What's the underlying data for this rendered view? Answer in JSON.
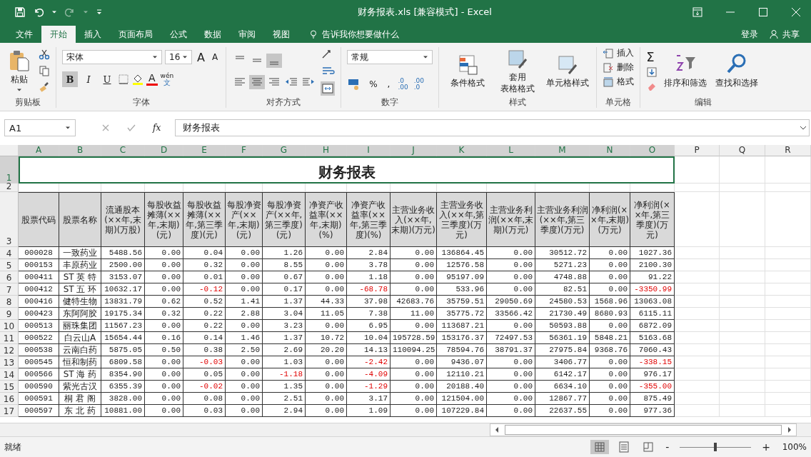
{
  "window": {
    "title": "财务报表.xls  [兼容模式] - Excel"
  },
  "tabs": [
    {
      "label": "文件",
      "selected": false
    },
    {
      "label": "开始",
      "selected": true
    },
    {
      "label": "插入",
      "selected": false
    },
    {
      "label": "页面布局",
      "selected": false
    },
    {
      "label": "公式",
      "selected": false
    },
    {
      "label": "数据",
      "selected": false
    },
    {
      "label": "审阅",
      "selected": false
    },
    {
      "label": "视图",
      "selected": false
    }
  ],
  "tell_me": "告诉我你想要做什么",
  "sign_in": "登录",
  "share": "共享",
  "ribbon": {
    "clipboard": {
      "label": "剪贴板",
      "paste": "粘贴"
    },
    "font": {
      "label": "字体",
      "font": "宋体",
      "size": "16",
      "grow": "A",
      "shrink": "A",
      "bold": {
        "text": "B",
        "selected": true
      },
      "italic": {
        "text": "I",
        "selected": false
      },
      "underline": {
        "text": "U",
        "selected": false
      },
      "phonetic": [
        "wén",
        "文"
      ],
      "font_color": "A"
    },
    "alignment": {
      "label": "对齐方式",
      "buttons": [
        {
          "kind": "top",
          "selected": false
        },
        {
          "kind": "middle",
          "selected": false
        },
        {
          "kind": "bottom",
          "selected": true
        },
        {
          "kind": "left",
          "selected": false
        },
        {
          "kind": "center",
          "selected": true
        },
        {
          "kind": "right",
          "selected": false
        },
        {
          "kind": "outdent",
          "selected": false
        },
        {
          "kind": "indent",
          "selected": false
        }
      ],
      "merge_selected": true
    },
    "number": {
      "label": "数字",
      "format": "常规",
      "percent": "%",
      "comma": ",",
      "increase_decimal": [
        ".0",
        ".00"
      ],
      "decrease_decimal": [
        ".00",
        ".0"
      ]
    },
    "styles": {
      "label": "样式",
      "buttons": [
        [
          "条件格式"
        ],
        [
          "套用",
          "表格格式"
        ],
        [
          "单元格样式"
        ]
      ]
    },
    "cells": {
      "label": "单元格",
      "items": [
        {
          "kind": "insert",
          "label": "插入"
        },
        {
          "kind": "delete",
          "label": "删除"
        },
        {
          "kind": "format",
          "label": "格式"
        }
      ]
    },
    "editing": {
      "label": "编辑",
      "sum": "Σ",
      "buttons": [
        {
          "kind": "sort",
          "label": "排序和筛选"
        },
        {
          "kind": "find",
          "label": "查找和选择"
        }
      ]
    }
  },
  "formula_bar": {
    "name_box": "A1",
    "fx": "fx",
    "value": "财务报表"
  },
  "sheet": {
    "columns": [
      "A",
      "B",
      "C",
      "D",
      "E",
      "F",
      "G",
      "H",
      "I",
      "J",
      "K",
      "L",
      "M",
      "N",
      "O",
      "P",
      "Q",
      "R"
    ],
    "title_row": "1",
    "title": "财务报表",
    "blank_row": "2",
    "header_row": "3",
    "headers": [
      "股票代码",
      "股票名称",
      "流通股本(××年,末期)(万股)",
      "每股收益摊薄(××年,末期)(元)",
      "每股收益摊薄(××年,第三季度)(元)",
      "每股净资产(××年,末期)(元)",
      "每股净资产(××年,第三季度)(元)",
      "净资产收益率(××年,末期)(%)",
      "净资产收益率(××年,第三季度)(%)",
      "主营业务收入(××年,末期)(万元)",
      "主营业务收入(××年,第三季度)(万元)",
      "主营业务利润(××年,末期)(万元)",
      "主营业务利润(××年,第三季度)(万元)",
      "净利润(××年,末期)(万元)",
      "净利润(××年,第三季度)(万元)"
    ],
    "rows": [
      {
        "row": "4",
        "cells": [
          "000028",
          "一致药业",
          "5488.56",
          "0.00",
          "0.04",
          "0.00",
          "1.26",
          "0.00",
          "2.84",
          "0.00",
          "136864.45",
          "0.00",
          "30512.72",
          "0.00",
          "1027.36"
        ],
        "negative": [
          false,
          false,
          false,
          false,
          false,
          false,
          false,
          false,
          false,
          false,
          false,
          false,
          false,
          false,
          false
        ]
      },
      {
        "row": "5",
        "cells": [
          "000153",
          "丰原药业",
          "2500.00",
          "0.00",
          "0.32",
          "0.00",
          "8.55",
          "0.00",
          "3.78",
          "0.00",
          "12576.58",
          "0.00",
          "5271.23",
          "0.00",
          "2100.30"
        ],
        "negative": [
          false,
          false,
          false,
          false,
          false,
          false,
          false,
          false,
          false,
          false,
          false,
          false,
          false,
          false,
          false
        ]
      },
      {
        "row": "6",
        "cells": [
          "000411",
          "ST 英 特",
          "3153.07",
          "0.00",
          "0.01",
          "0.00",
          "0.67",
          "0.00",
          "1.18",
          "0.00",
          "95197.09",
          "0.00",
          "4748.88",
          "0.00",
          "91.22"
        ],
        "negative": [
          false,
          false,
          false,
          false,
          false,
          false,
          false,
          false,
          false,
          false,
          false,
          false,
          false,
          false,
          false
        ]
      },
      {
        "row": "7",
        "cells": [
          "000412",
          "ST 五 环",
          "10632.17",
          "0.00",
          "-0.12",
          "0.00",
          "0.17",
          "0.00",
          "-68.78",
          "0.00",
          "533.96",
          "0.00",
          "82.51",
          "0.00",
          "-3350.99"
        ],
        "negative": [
          false,
          false,
          false,
          false,
          true,
          false,
          false,
          false,
          true,
          false,
          false,
          false,
          false,
          false,
          true
        ]
      },
      {
        "row": "8",
        "cells": [
          "000416",
          "健特生物",
          "13831.79",
          "0.62",
          "0.52",
          "1.41",
          "1.37",
          "44.33",
          "37.98",
          "42683.76",
          "35759.51",
          "29050.69",
          "24580.53",
          "1568.96",
          "13063.08"
        ],
        "negative": [
          false,
          false,
          false,
          false,
          false,
          false,
          false,
          false,
          false,
          false,
          false,
          false,
          false,
          false,
          false
        ]
      },
      {
        "row": "9",
        "cells": [
          "000423",
          "东阿阿胶",
          "19175.34",
          "0.32",
          "0.22",
          "2.88",
          "3.04",
          "11.05",
          "7.38",
          "11.00",
          "35775.72",
          "33566.42",
          "21730.49",
          "8680.93",
          "6115.11"
        ],
        "negative": [
          false,
          false,
          false,
          false,
          false,
          false,
          false,
          false,
          false,
          false,
          false,
          false,
          false,
          false,
          false
        ]
      },
      {
        "row": "10",
        "cells": [
          "000513",
          "丽珠集团",
          "11567.23",
          "0.00",
          "0.22",
          "0.00",
          "3.23",
          "0.00",
          "6.95",
          "0.00",
          "113687.21",
          "0.00",
          "50593.88",
          "0.00",
          "6872.09"
        ],
        "negative": [
          false,
          false,
          false,
          false,
          false,
          false,
          false,
          false,
          false,
          false,
          false,
          false,
          false,
          false,
          false
        ]
      },
      {
        "row": "11",
        "cells": [
          "000522",
          "白云山A",
          "15654.44",
          "0.16",
          "0.14",
          "1.46",
          "1.37",
          "10.72",
          "10.04",
          "195728.59",
          "153176.37",
          "72497.53",
          "56361.19",
          "5848.21",
          "5163.68"
        ],
        "negative": [
          false,
          false,
          false,
          false,
          false,
          false,
          false,
          false,
          false,
          false,
          false,
          false,
          false,
          false,
          false
        ]
      },
      {
        "row": "12",
        "cells": [
          "000538",
          "云南白药",
          "5875.05",
          "0.50",
          "0.38",
          "2.50",
          "2.69",
          "20.20",
          "14.13",
          "110094.25",
          "78594.76",
          "38791.37",
          "27975.84",
          "9368.76",
          "7060.43"
        ],
        "negative": [
          false,
          false,
          false,
          false,
          false,
          false,
          false,
          false,
          false,
          false,
          false,
          false,
          false,
          false,
          false
        ]
      },
      {
        "row": "13",
        "cells": [
          "000545",
          "恒和制药",
          "6809.58",
          "0.00",
          "-0.03",
          "0.00",
          "1.03",
          "0.00",
          "-2.42",
          "0.00",
          "9436.07",
          "0.00",
          "3406.77",
          "0.00",
          "-338.15"
        ],
        "negative": [
          false,
          false,
          false,
          false,
          true,
          false,
          false,
          false,
          true,
          false,
          false,
          false,
          false,
          false,
          true
        ]
      },
      {
        "row": "14",
        "cells": [
          "000566",
          "ST 海 药",
          "8354.90",
          "0.00",
          "0.05",
          "0.00",
          "-1.18",
          "0.00",
          "-4.09",
          "0.00",
          "12110.21",
          "0.00",
          "6142.17",
          "0.00",
          "976.17"
        ],
        "negative": [
          false,
          false,
          false,
          false,
          false,
          false,
          true,
          false,
          true,
          false,
          false,
          false,
          false,
          false,
          false
        ]
      },
      {
        "row": "15",
        "cells": [
          "000590",
          "紫光古汉",
          "6355.39",
          "0.00",
          "-0.02",
          "0.00",
          "1.35",
          "0.00",
          "-1.29",
          "0.00",
          "20188.40",
          "0.00",
          "6634.10",
          "0.00",
          "-355.00"
        ],
        "negative": [
          false,
          false,
          false,
          false,
          true,
          false,
          false,
          false,
          true,
          false,
          false,
          false,
          false,
          false,
          true
        ]
      },
      {
        "row": "16",
        "cells": [
          "000591",
          "桐 君 阁",
          "3828.00",
          "0.00",
          "0.08",
          "0.00",
          "2.51",
          "0.00",
          "3.17",
          "0.00",
          "121504.00",
          "0.00",
          "12867.77",
          "0.00",
          "875.49"
        ],
        "negative": [
          false,
          false,
          false,
          false,
          false,
          false,
          false,
          false,
          false,
          false,
          false,
          false,
          false,
          false,
          false
        ]
      },
      {
        "row": "17",
        "cells": [
          "000597",
          "东 北 药",
          "10881.00",
          "0.00",
          "0.03",
          "0.00",
          "2.94",
          "0.00",
          "1.09",
          "0.00",
          "107229.84",
          "0.00",
          "22637.55",
          "0.00",
          "977.36"
        ],
        "negative": [
          false,
          false,
          false,
          false,
          false,
          false,
          false,
          false,
          false,
          false,
          false,
          false,
          false,
          false,
          false
        ]
      }
    ]
  },
  "status_bar": {
    "text": "就绪",
    "views": [
      {
        "kind": "normal",
        "selected": true
      },
      {
        "kind": "page_layout",
        "selected": false
      },
      {
        "kind": "page_break",
        "selected": false
      }
    ],
    "zoom": {
      "level": 0.5,
      "minus": "-",
      "plus": "+",
      "text": "100%"
    }
  }
}
